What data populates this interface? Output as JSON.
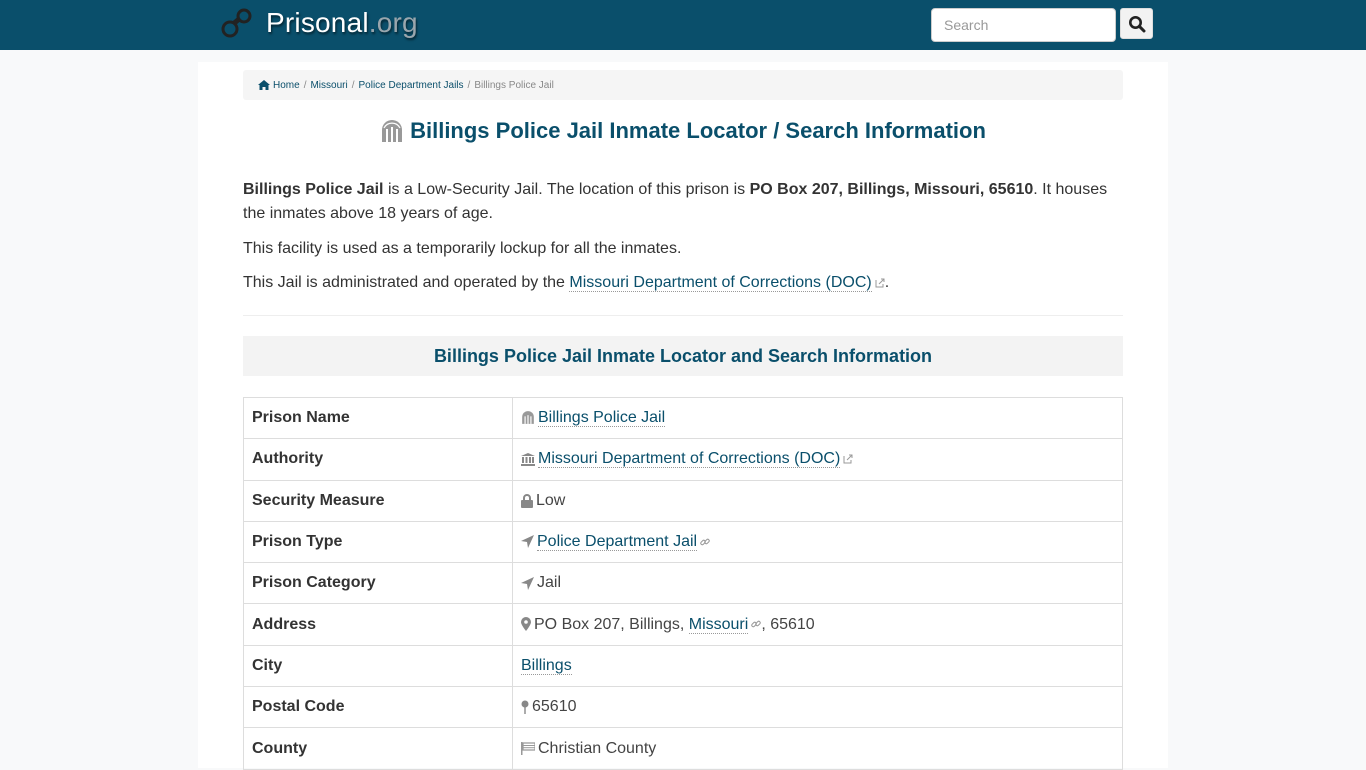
{
  "header": {
    "brand_main": "Prisonal",
    "brand_tld": ".org",
    "brand_icon": "handcuffs-icon",
    "search": {
      "placeholder": "Search",
      "value": "",
      "button_icon": "search-icon"
    }
  },
  "breadcrumb": {
    "home_icon": "home-icon",
    "items": [
      {
        "label": "Home",
        "link": true
      },
      {
        "label": "Missouri",
        "link": true
      },
      {
        "label": "Police Department Jails",
        "link": true
      },
      {
        "label": "Billings Police Jail",
        "link": false
      }
    ],
    "separator": "/"
  },
  "page": {
    "title_icon": "prison-gate-icon",
    "title": "Billings Police Jail Inmate Locator / Search Information",
    "intro": {
      "name": "Billings Police Jail",
      "text_a": " is a Low-Security Jail. The location of this prison is ",
      "address": "PO Box 207, Billings, Missouri, 65610",
      "text_b": ". It houses the inmates above 18 years of age."
    },
    "para2": "This facility is used as a temporarily lockup for all the inmates.",
    "para3": {
      "text": "This Jail is administrated and operated by the ",
      "link": "Missouri Department of Corrections (DOC)",
      "end": "."
    },
    "section_heading": "Billings Police Jail Inmate Locator and Search Information"
  },
  "table": {
    "rows": [
      {
        "label": "Prison Name",
        "icon": "prison-gate-icon",
        "value": "Billings Police Jail",
        "link": true
      },
      {
        "label": "Authority",
        "icon": "institution-icon",
        "value": "Missouri Department of Corrections (DOC)",
        "link": true,
        "external": true
      },
      {
        "label": "Security Measure",
        "icon": "lock-icon",
        "value": "Low"
      },
      {
        "label": "Prison Type",
        "icon": "location-arrow-icon",
        "value": "Police Department Jail",
        "link": true,
        "chain": true
      },
      {
        "label": "Prison Category",
        "icon": "location-arrow-icon",
        "value": "Jail"
      },
      {
        "label": "Address",
        "icon": "map-marker-icon",
        "value_a": "PO Box 207, Billings, ",
        "value_link": "Missouri",
        "value_b": ", 65610"
      },
      {
        "label": "City",
        "value": "Billings",
        "link": true
      },
      {
        "label": "Postal Code",
        "icon": "map-pin-icon",
        "value": "65610"
      },
      {
        "label": "County",
        "icon": "flag-icon",
        "value": "Christian County"
      }
    ]
  },
  "colors": {
    "brand": "#0a4f6b",
    "icon_gray": "#888888",
    "breadcrumb_bg": "#f5f5f5"
  }
}
